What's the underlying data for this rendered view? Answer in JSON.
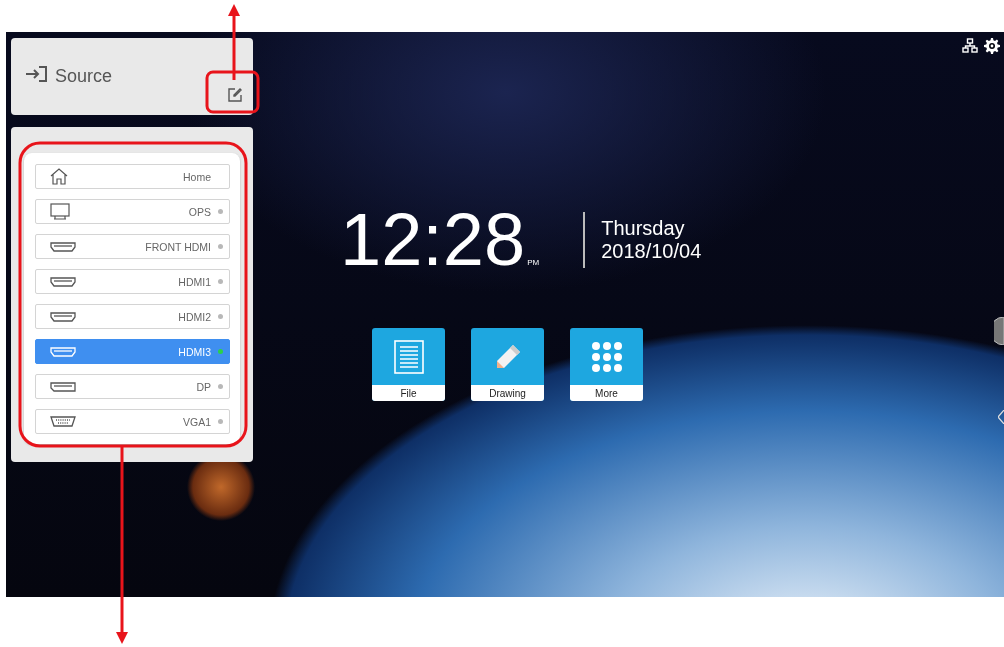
{
  "source_panel": {
    "title": "Source"
  },
  "source_list": [
    {
      "label": "Home",
      "kind": "home",
      "selected": false
    },
    {
      "label": "OPS",
      "kind": "monitor",
      "connected": false,
      "selected": false
    },
    {
      "label": "FRONT HDMI",
      "kind": "hdmi",
      "connected": false,
      "selected": false
    },
    {
      "label": "HDMI1",
      "kind": "hdmi",
      "connected": false,
      "selected": false
    },
    {
      "label": "HDMI2",
      "kind": "hdmi",
      "connected": false,
      "selected": false
    },
    {
      "label": "HDMI3",
      "kind": "hdmi",
      "connected": true,
      "selected": true
    },
    {
      "label": "DP",
      "kind": "displayport",
      "connected": false,
      "selected": false
    },
    {
      "label": "VGA1",
      "kind": "vga",
      "connected": false,
      "selected": false
    }
  ],
  "clock": {
    "time": "12:28",
    "meridiem": "PM",
    "weekday": "Thursday",
    "date": "2018/10/04"
  },
  "apps": [
    {
      "label": "File",
      "kind": "file"
    },
    {
      "label": "Drawing",
      "kind": "pencil"
    },
    {
      "label": "More",
      "kind": "grid"
    }
  ]
}
